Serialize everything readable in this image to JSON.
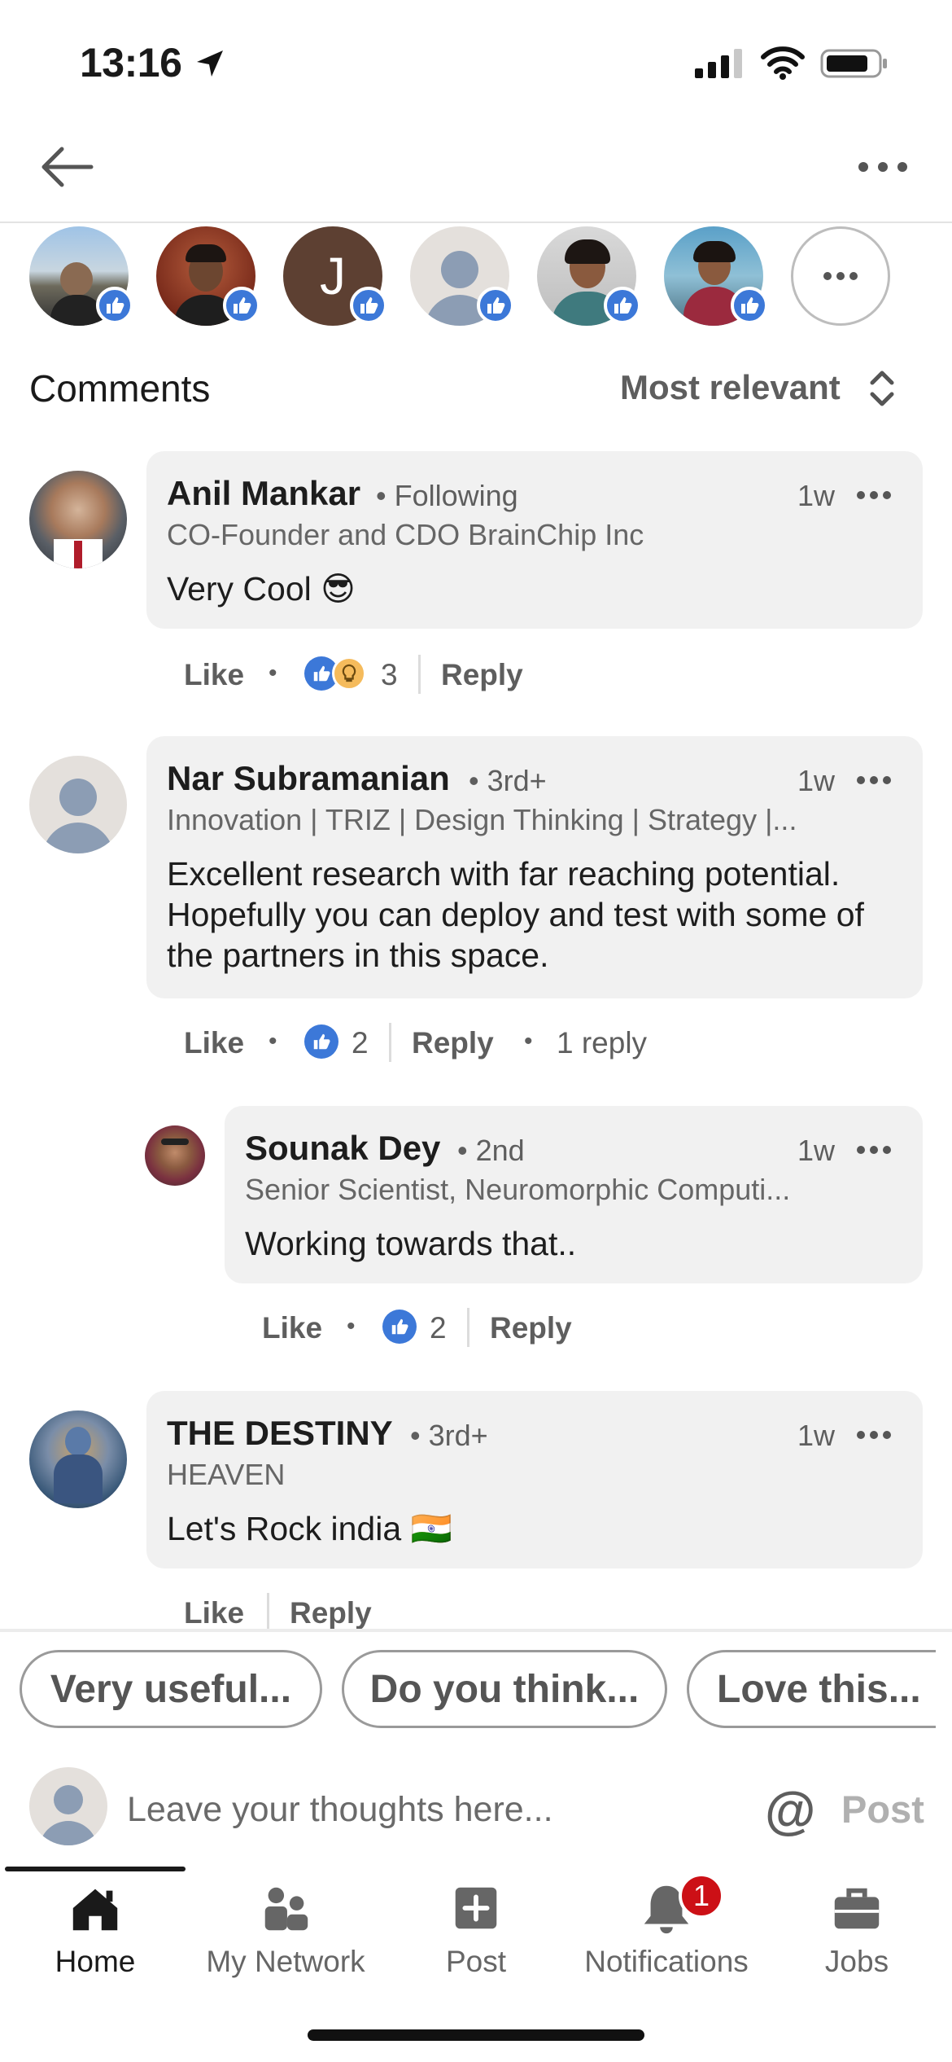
{
  "status_bar": {
    "time": "13:16"
  },
  "header": {
    "back_icon": "back-arrow-icon",
    "more_icon": "more-icon"
  },
  "reactors": {
    "avatars": [
      "reactor-1",
      "reactor-2",
      "reactor-3",
      "reactor-4",
      "reactor-5",
      "reactor-6"
    ],
    "letter_avatar": "J",
    "more_icon": "more-icon"
  },
  "comments_section": {
    "title": "Comments",
    "sort": "Most relevant"
  },
  "comments": [
    {
      "name": "Anil Mankar",
      "degree": "• Following",
      "headline": "CO-Founder and CDO BrainChip Inc",
      "time": "1w",
      "body": "Very Cool 😎",
      "like_label": "Like",
      "reaction_count": "3",
      "reply_label": "Reply"
    },
    {
      "name": "Nar Subramanian",
      "degree": "• 3rd+",
      "headline": "Innovation | TRIZ | Design Thinking | Strategy |...",
      "time": "1w",
      "body": "Excellent research with far reaching potential. Hopefully you can deploy and test with some of the partners in this space.",
      "like_label": "Like",
      "reaction_count": "2",
      "reply_label": "Reply",
      "replies_label": "1 reply"
    },
    {
      "name": "Sounak Dey",
      "degree": "• 2nd",
      "headline": "Senior Scientist, Neuromorphic Computi...",
      "time": "1w",
      "body": "Working towards that..",
      "like_label": "Like",
      "reaction_count": "2",
      "reply_label": "Reply"
    },
    {
      "name": "THE DESTINY",
      "degree": "• 3rd+",
      "headline": "HEAVEN",
      "time": "1w",
      "body": "Let's Rock india 🇮🇳",
      "like_label": "Like",
      "reply_label": "Reply"
    }
  ],
  "suggestions": [
    "Very useful...",
    "Do you think...",
    "Love this..."
  ],
  "composer": {
    "placeholder": "Leave your thoughts here...",
    "mention": "@",
    "post_label": "Post"
  },
  "bottom_nav": {
    "items": [
      {
        "label": "Home",
        "icon": "home-icon"
      },
      {
        "label": "My Network",
        "icon": "network-icon"
      },
      {
        "label": "Post",
        "icon": "post-icon"
      },
      {
        "label": "Notifications",
        "icon": "bell-icon",
        "badge": "1"
      },
      {
        "label": "Jobs",
        "icon": "briefcase-icon"
      }
    ]
  },
  "colors": {
    "like_blue": "#3c78d8",
    "insight_yellow": "#f5bb5c",
    "badge_red": "#cc1016",
    "bubble": "#f1f1f1"
  }
}
